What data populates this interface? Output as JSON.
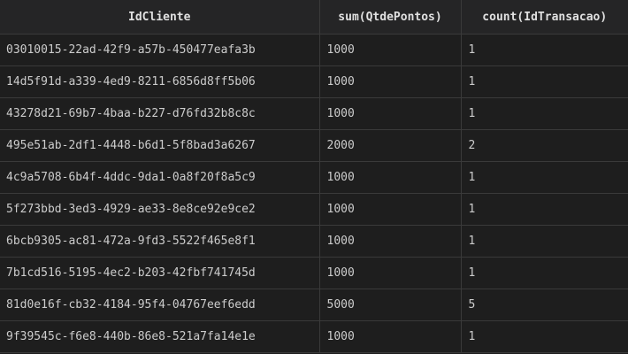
{
  "results": {
    "columns": [
      "IdCliente",
      "sum(QtdePontos)",
      "count(IdTransacao)"
    ],
    "rows": [
      [
        "03010015-22ad-42f9-a57b-450477eafa3b",
        "1000",
        "1"
      ],
      [
        "14d5f91d-a339-4ed9-8211-6856d8ff5b06",
        "1000",
        "1"
      ],
      [
        "43278d21-69b7-4baa-b227-d76fd32b8c8c",
        "1000",
        "1"
      ],
      [
        "495e51ab-2df1-4448-b6d1-5f8bad3a6267",
        "2000",
        "2"
      ],
      [
        "4c9a5708-6b4f-4ddc-9da1-0a8f20f8a5c9",
        "1000",
        "1"
      ],
      [
        "5f273bbd-3ed3-4929-ae33-8e8ce92e9ce2",
        "1000",
        "1"
      ],
      [
        "6bcb9305-ac81-472a-9fd3-5522f465e8f1",
        "1000",
        "1"
      ],
      [
        "7b1cd516-5195-4ec2-b203-42fbf741745d",
        "1000",
        "1"
      ],
      [
        "81d0e16f-cb32-4184-95f4-04767eef6edd",
        "5000",
        "5"
      ],
      [
        "9f39545c-f6e8-440b-86e8-521a7fa14e1e",
        "1000",
        "1"
      ]
    ]
  }
}
